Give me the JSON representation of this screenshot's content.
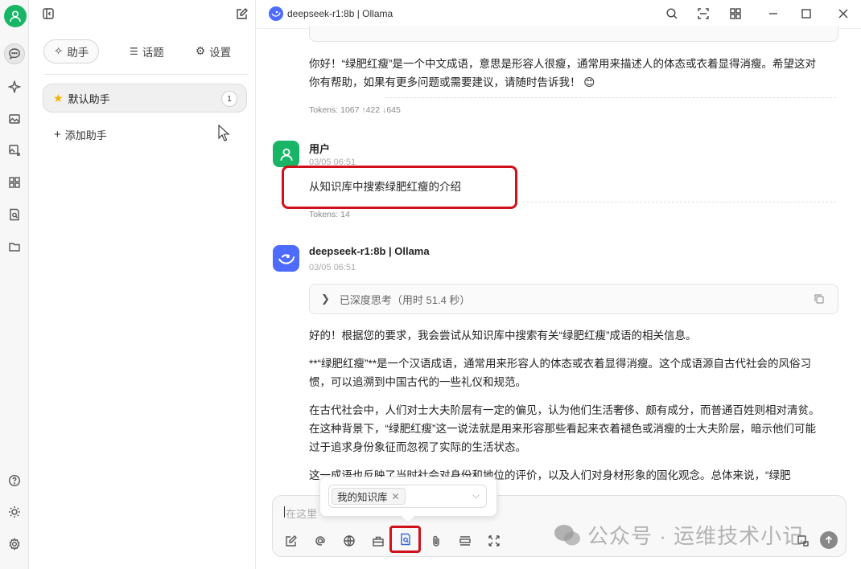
{
  "sidebar": {
    "tabs": [
      {
        "label": "助手",
        "icon": "sparkle-icon"
      },
      {
        "label": "话题",
        "icon": "list-icon"
      },
      {
        "label": "设置",
        "icon": "gear-icon"
      }
    ],
    "assistant": {
      "name": "默认助手",
      "count": "1"
    },
    "add_label": "添加助手"
  },
  "topbar": {
    "title": "deepseek-r1:8b | Ollama"
  },
  "messages": {
    "prev_text_1": "你好！“绿肥红瘦”是一个中文成语，意思是形容人很瘦，通常用来描述人的体态或衣着显得消瘦。希望这对",
    "prev_text_2": "你有帮助，如果有更多问题或需要建议，请随时告诉我！",
    "prev_emoji": "😊",
    "prev_tokens": "Tokens: 1067 ↑422 ↓645",
    "user": {
      "sender": "用户",
      "time": "03/05 06:51",
      "text": "从知识库中搜索绿肥红瘦的介绍",
      "tokens": "Tokens: 14"
    },
    "model": {
      "sender": "deepseek-r1:8b | Ollama",
      "time": "03/05 06:51",
      "think_label": "已深度思考（用时 51.4 秒）",
      "paragraphs": [
        "好的！根据您的要求，我会尝试从知识库中搜索有关“绿肥红瘦”成语的相关信息。",
        "**“绿肥红瘦”**是一个汉语成语，通常用来形容人的体态或衣着显得消瘦。这个成语源自古代社会的风俗习",
        "惯，可以追溯到中国古代的一些礼仪和规范。",
        "在古代社会中，人们对士大夫阶层有一定的偏见，认为他们生活奢侈、颇有成分，而普通百姓则相对清贫。",
        "在这种背景下，“绿肥红瘦”这一说法就是用来形容那些看起来衣着褪色或消瘦的士大夫阶层，暗示他们可能",
        "过于追求身份象征而忽视了实际的生活状态。",
        "这一成语也反映了当时社会对身份和地位的评价，以及人们对身材形象的固化观念。总体来说，“绿肥"
      ]
    }
  },
  "input": {
    "placeholder": "在这里",
    "kb_tag": "我的知识库"
  },
  "watermark": "公众号 · 运维技术小记",
  "colors": {
    "accent_green": "#18b566",
    "highlight_red": "#d0101a",
    "model_blue": "#4d6bfe"
  }
}
